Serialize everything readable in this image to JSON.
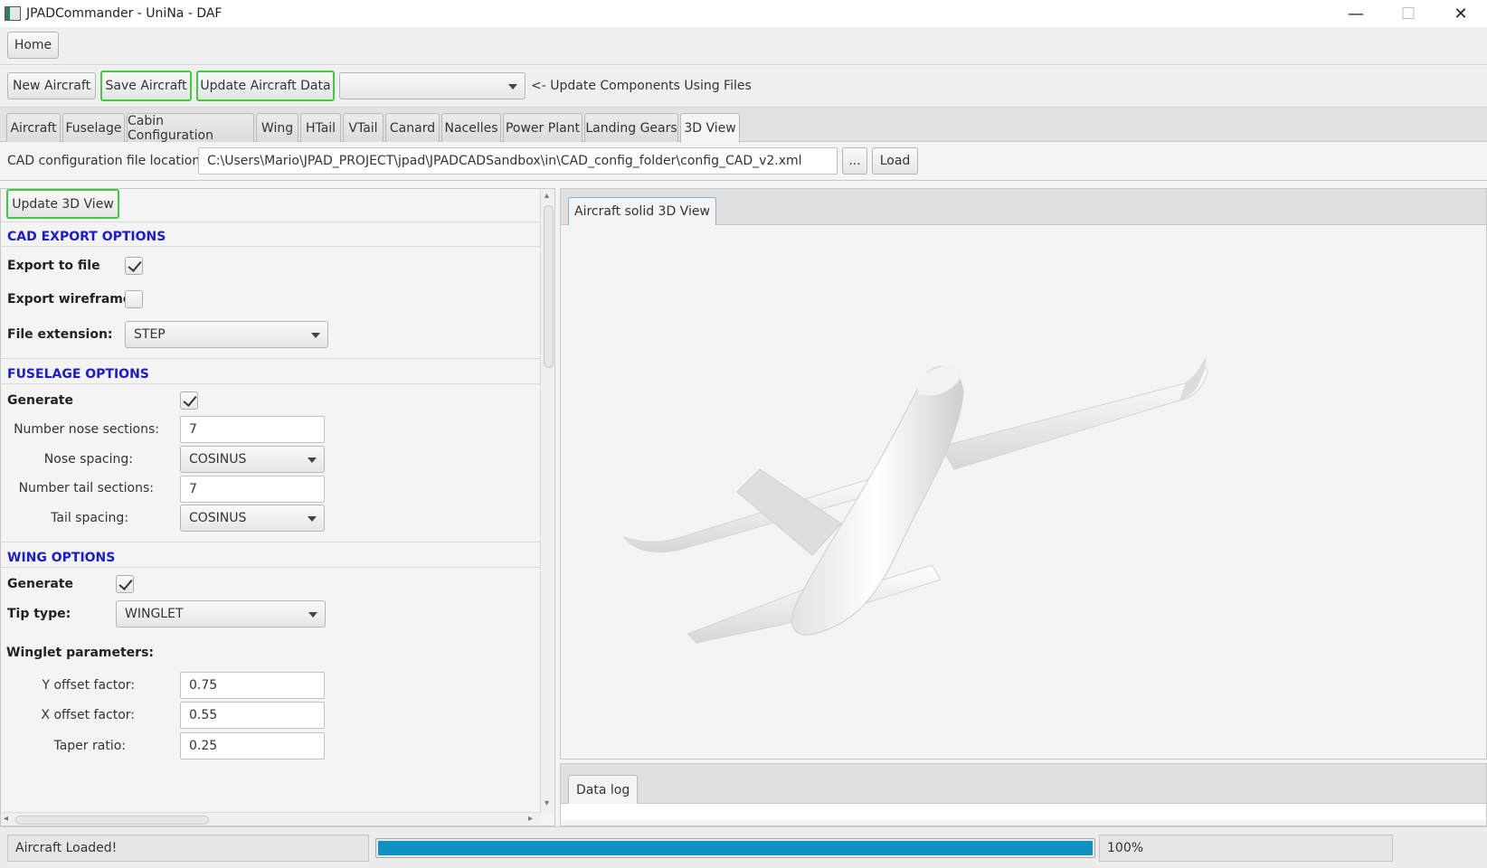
{
  "window": {
    "title": "JPADCommander - UniNa - DAF",
    "minimize_glyph": "—",
    "maximize_glyph": "☐",
    "close_glyph": "✕"
  },
  "menu": {
    "home_label": "Home"
  },
  "toolbar": {
    "new_aircraft": "New Aircraft",
    "save_aircraft": "Save Aircraft",
    "update_aircraft_data": "Update Aircraft Data",
    "components_combo_value": "",
    "update_components_hint": "<- Update Components Using Files",
    "highlight_color": "#3ccd3c"
  },
  "tabs": [
    "Aircraft",
    "Fuselage",
    "Cabin Configuration",
    "Wing",
    "HTail",
    "VTail",
    "Canard",
    "Nacelles",
    "Power Plant",
    "Landing Gears",
    "3D View"
  ],
  "active_tab": "3D View",
  "cad_config": {
    "label": "CAD configuration file location:",
    "path": "C:\\Users\\Mario\\JPAD_PROJECT\\jpad\\JPADCADSandbox\\in\\CAD_config_folder\\config_CAD_v2.xml",
    "browse_label": "...",
    "load_label": "Load"
  },
  "options": {
    "update_3d_view": "Update 3D View",
    "cad_export": {
      "title": "CAD EXPORT OPTIONS",
      "export_to_file_label": "Export to file",
      "export_to_file": true,
      "export_wireframe_label": "Export wireframe",
      "export_wireframe": false,
      "file_extension_label": "File extension:",
      "file_extension": "STEP"
    },
    "fuselage": {
      "title": "FUSELAGE OPTIONS",
      "generate_label": "Generate",
      "generate": true,
      "nose_sections_label": "Number nose sections:",
      "nose_sections": "7",
      "nose_spacing_label": "Nose spacing:",
      "nose_spacing": "COSINUS",
      "tail_sections_label": "Number tail sections:",
      "tail_sections": "7",
      "tail_spacing_label": "Tail spacing:",
      "tail_spacing": "COSINUS"
    },
    "wing": {
      "title": "WING OPTIONS",
      "generate_label": "Generate",
      "generate": true,
      "tip_type_label": "Tip type:",
      "tip_type": "WINGLET",
      "winglet_params_label": "Winglet parameters:",
      "y_offset_label": "Y offset factor:",
      "y_offset": "0.75",
      "x_offset_label": "X offset factor:",
      "x_offset": "0.55",
      "taper_ratio_label": "Taper ratio:",
      "taper_ratio": "0.25"
    },
    "section_title_color": "#1b1bd4"
  },
  "view3d": {
    "tab_label": "Aircraft solid 3D View"
  },
  "log": {
    "tab_label": "Data log"
  },
  "status": {
    "message": "Aircraft Loaded!",
    "progress_fraction": 1.0,
    "progress_text": "100%",
    "progress_color": "#0f92c3"
  }
}
